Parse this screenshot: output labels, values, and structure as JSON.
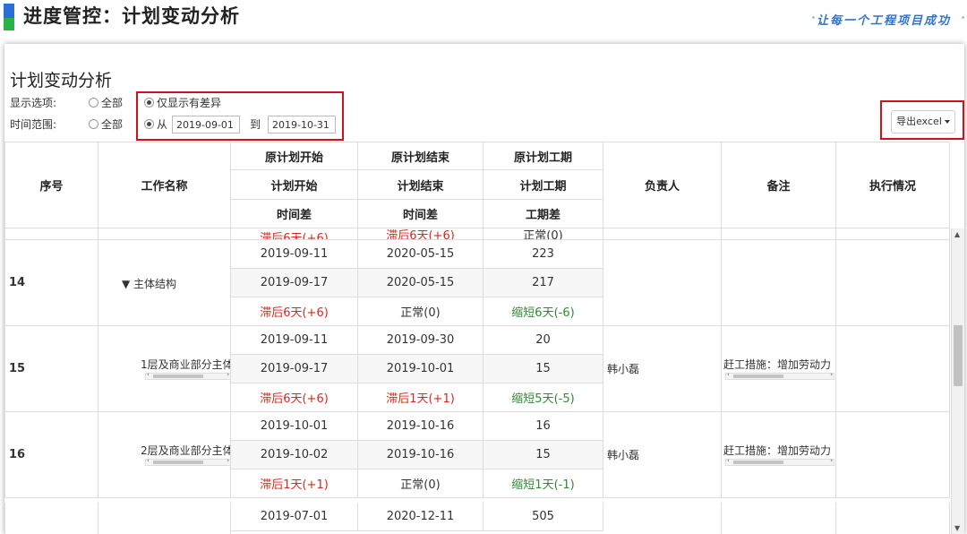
{
  "header": {
    "title": "进度管控：计划变动分析",
    "slogan": "让每一个工程项目成功",
    "colors": {
      "accent_blue": "#2b6fd6",
      "accent_green": "#27b24a",
      "slogan": "#2f73c9"
    }
  },
  "panel": {
    "title": "计划变动分析",
    "display_options": {
      "label": "显示选项:",
      "all": "全部",
      "diff_only": "仅显示有差异",
      "selected": "diff_only"
    },
    "time_range": {
      "label": "时间范围:",
      "all": "全部",
      "from": "从",
      "start": "2019-09-01",
      "to": "到",
      "end": "2019-10-31",
      "selected": "from"
    },
    "export_label": "导出excel",
    "highlight_color": "#d0111b"
  },
  "table": {
    "headers": {
      "seq": "序号",
      "name": "工作名称",
      "orig_start": "原计划开始",
      "orig_end": "原计划结束",
      "orig_duration": "原计划工期",
      "plan_start": "计划开始",
      "plan_end": "计划结束",
      "plan_duration": "计划工期",
      "diff_time_1": "时间差",
      "diff_time_2": "时间差",
      "diff_duration": "工期差",
      "owner": "负责人",
      "remark": "备注",
      "status": "执行情况"
    },
    "partial_top_row": {
      "start_diff": "滞后6天(+6)",
      "end_diff": "滞后6天(+6)",
      "duration_diff": "正常(0)"
    },
    "groups": [
      {
        "seq": "14",
        "name": "▼ 主体结构",
        "orig_start": "2019-09-11",
        "orig_end": "2020-05-15",
        "orig_duration": "223",
        "plan_start": "2019-09-17",
        "plan_end": "2020-05-15",
        "plan_duration": "217",
        "start_diff": "滞后6天(+6)",
        "end_diff": "正常(0)",
        "duration_diff": "缩短6天(-6)",
        "owner": "",
        "remark": ""
      },
      {
        "seq": "15",
        "name": "1层及商业部分主体",
        "orig_start": "2019-09-11",
        "orig_end": "2019-09-30",
        "orig_duration": "20",
        "plan_start": "2019-09-17",
        "plan_end": "2019-10-01",
        "plan_duration": "15",
        "start_diff": "滞后6天(+6)",
        "end_diff": "滞后1天(+1)",
        "duration_diff": "缩短5天(-5)",
        "owner": "韩小磊",
        "remark": "赶工措施：增加劳动力"
      },
      {
        "seq": "16",
        "name": "2层及商业部分主体",
        "orig_start": "2019-10-01",
        "orig_end": "2019-10-16",
        "orig_duration": "16",
        "plan_start": "2019-10-02",
        "plan_end": "2019-10-16",
        "plan_duration": "15",
        "start_diff": "滞后1天(+1)",
        "end_diff": "正常(0)",
        "duration_diff": "缩短1天(-1)",
        "owner": "韩小磊",
        "remark": "赶工措施：增加劳动力"
      }
    ],
    "partial_bottom_row": {
      "orig_start": "2019-07-01",
      "orig_end": "2020-12-11",
      "orig_duration": "505"
    },
    "colors": {
      "late": "#d9291c",
      "shortened": "#2e8b2e"
    }
  }
}
